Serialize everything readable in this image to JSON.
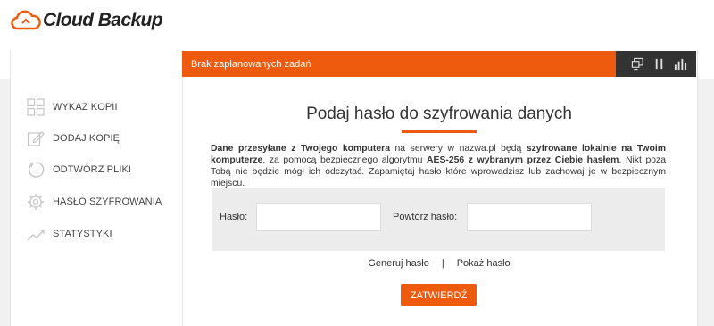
{
  "app": {
    "logo_text": "Cloud Backup"
  },
  "sidebar": {
    "items": [
      {
        "label": "WYKAZ KOPII",
        "icon": "grid-icon"
      },
      {
        "label": "DODAJ KOPIĘ",
        "icon": "edit-icon"
      },
      {
        "label": "ODTWÓRZ PLIKI",
        "icon": "restore-icon"
      },
      {
        "label": "HASŁO SZYFROWANIA",
        "icon": "gear-icon"
      },
      {
        "label": "STATYSTYKI",
        "icon": "chart-line-icon"
      }
    ]
  },
  "topbar": {
    "status_text": "Brak zaplanowanych zadań",
    "icons": [
      "monitor-icon",
      "pause-icon",
      "bar-chart-icon"
    ]
  },
  "main": {
    "title": "Podaj hasło do szyfrowania danych",
    "desc_parts": [
      "Dane przesyłane z Twojego komputera",
      " na serwery w nazwa.pl będą ",
      "szyfrowane lokalnie na Twoim komputerze",
      ", za pomocą bezpiecznego algorytmu ",
      "AES-256 z wybranym przez Ciebie hasłem",
      ". Nikt poza Tobą nie będzie mógł ich odczytać. Zapamiętaj hasło które wprowadzisz lub zachowaj je w bezpiecznym miejscu."
    ],
    "form": {
      "password_label": "Hasło:",
      "password_value": "",
      "repeat_label": "Powtórz hasło:",
      "repeat_value": ""
    },
    "links": {
      "generate": "Generuj hasło",
      "separator": "|",
      "show": "Pokaż hasło"
    },
    "submit_label": "ZATWIERDŹ"
  },
  "colors": {
    "accent": "#ee5a0e",
    "dark_bar": "#333333",
    "background_band": "#f1f1f1"
  }
}
